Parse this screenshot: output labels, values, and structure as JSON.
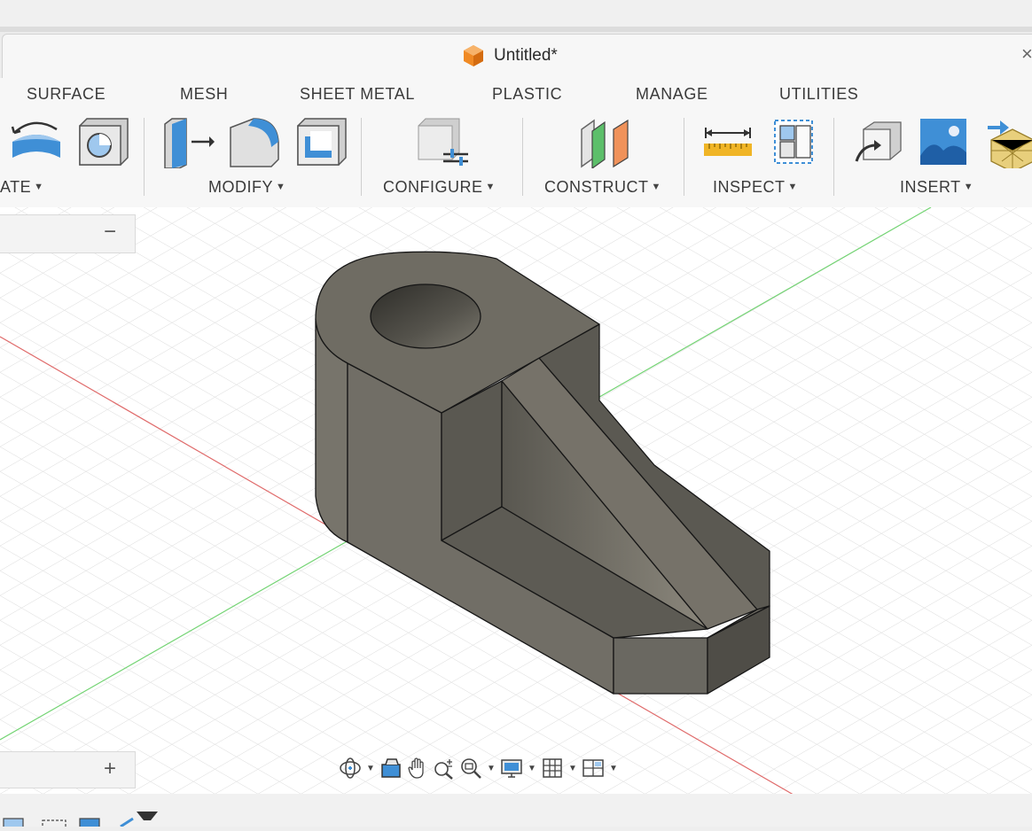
{
  "document": {
    "title": "Untitled*",
    "close_glyph": "×"
  },
  "ribbon_tabs": [
    {
      "label": "SURFACE"
    },
    {
      "label": "MESH"
    },
    {
      "label": "SHEET METAL"
    },
    {
      "label": "PLASTIC"
    },
    {
      "label": "MANAGE"
    },
    {
      "label": "UTILITIES"
    }
  ],
  "tool_groups": [
    {
      "label": "ATE"
    },
    {
      "label": "MODIFY"
    },
    {
      "label": "CONFIGURE"
    },
    {
      "label": "CONSTRUCT"
    },
    {
      "label": "INSPECT"
    },
    {
      "label": "INSERT"
    }
  ],
  "icons": {
    "tools": [
      "surface-patch-icon",
      "surface-solid-icon",
      "press-pull-icon",
      "fillet-icon",
      "shell-icon",
      "configure-icon",
      "offset-plane-icon",
      "measure-icon",
      "interference-icon",
      "insert-derive-icon",
      "insert-canvas-icon",
      "insert-mesh-icon"
    ],
    "navigation": [
      "orbit-icon",
      "look-at-icon",
      "pan-icon",
      "zoom-icon",
      "fit-icon",
      "display-settings-icon",
      "grid-icon",
      "viewports-icon"
    ]
  },
  "browser_panel": {
    "collapse_glyph": "−"
  },
  "comments_panel": {
    "expand_glyph": "+"
  },
  "colors": {
    "accent_orange": "#f08a24",
    "icon_blue": "#3f8fd6",
    "model_face": "#6f6c63",
    "x_axis": "#e05a5a",
    "y_axis": "#6ad36a"
  }
}
